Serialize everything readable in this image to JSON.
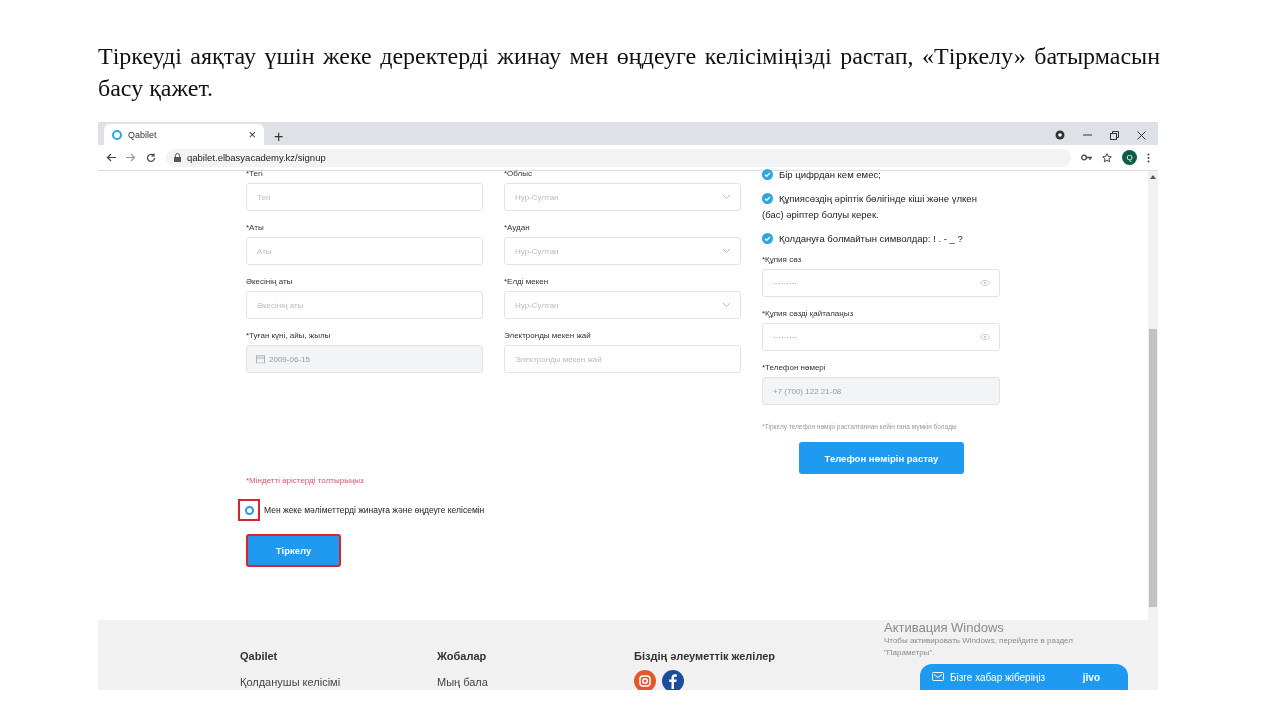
{
  "caption": "Тіркеуді аяқтау үшін жеке деректерді жинау мен өңдеуге келісіміңізді растап, «Тіркелу» батырмасын басу қажет.",
  "browser": {
    "tab_title": "Qabilet",
    "tab_close": "×",
    "new_tab": "+",
    "url": "qabilet.elbasyacademy.kz/signup",
    "profile": "Q"
  },
  "form": {
    "column_1": [
      {
        "kind": "text",
        "label": "*Тегі",
        "placeholder": "Тегі",
        "disabled": false
      },
      {
        "kind": "text",
        "label": "*Аты",
        "placeholder": "Аты",
        "disabled": false
      },
      {
        "kind": "text",
        "label": "Әкесінің аты",
        "placeholder": "Әкесінің аты",
        "disabled": false
      },
      {
        "kind": "date",
        "label": "*Туған күні, айы, жылы",
        "value": "2009-06-15",
        "disabled": true
      }
    ],
    "column_2": [
      {
        "kind": "select",
        "label": "*Облыс",
        "placeholder": "Нур-Султан",
        "disabled": false
      },
      {
        "kind": "select",
        "label": "*Аудан",
        "placeholder": "Нур-Султан",
        "disabled": false
      },
      {
        "kind": "select",
        "label": "*Елді мекен",
        "placeholder": "Нур-Султан",
        "disabled": false
      },
      {
        "kind": "text",
        "label": "Электронды мекен жай",
        "placeholder": "Электронды мекен жай",
        "disabled": false
      }
    ],
    "password_rules": [
      {
        "text": "Бір цифрдан кем емес;",
        "checked": true
      },
      {
        "text": "Құпиясөздің әріптік бөлігінде кіші және үлкен (бас) әріптер болуы керек.",
        "checked": true
      },
      {
        "text": "Қолдануға болмайтын символдар: ! . - _ ?",
        "checked": true
      }
    ],
    "column_3": [
      {
        "kind": "password",
        "label": "*Құпия сөз",
        "value": "·········",
        "disabled": false
      },
      {
        "kind": "password",
        "label": "*Құпия сөзді қайталаңыз",
        "value": "·········",
        "disabled": false
      },
      {
        "kind": "text",
        "label": "*Телефон нөмері",
        "value": "+7 (700) 122 21-08",
        "disabled": true
      }
    ],
    "phone_note": "*Тіркелу телефон нөмірі расталғаннан кейін ғана мүмкін болады",
    "confirm_phone_button": "Телефон нөмірін растау",
    "required_note": "*Міндетті өрістерді толтырыңыз",
    "consent": {
      "label": "Мен жеке мәліметтерді жинауға және өңдеуге келісемін",
      "checked": true
    },
    "submit_button": "Тіркелу"
  },
  "footer": {
    "columns": [
      {
        "title": "Qabilet",
        "link": "Қолданушы келісімі"
      },
      {
        "title": "Жобалар",
        "link": "Мың бала"
      }
    ],
    "social_title": "Біздің әлеуметтік желілер"
  },
  "windows_notice": {
    "title": "Активация Windows",
    "text": "Чтобы активировать Windows, перейдите в раздел \"Параметры\"."
  },
  "chat": {
    "label": "Бізге хабар жіберіңіз",
    "brand": "jivo"
  }
}
